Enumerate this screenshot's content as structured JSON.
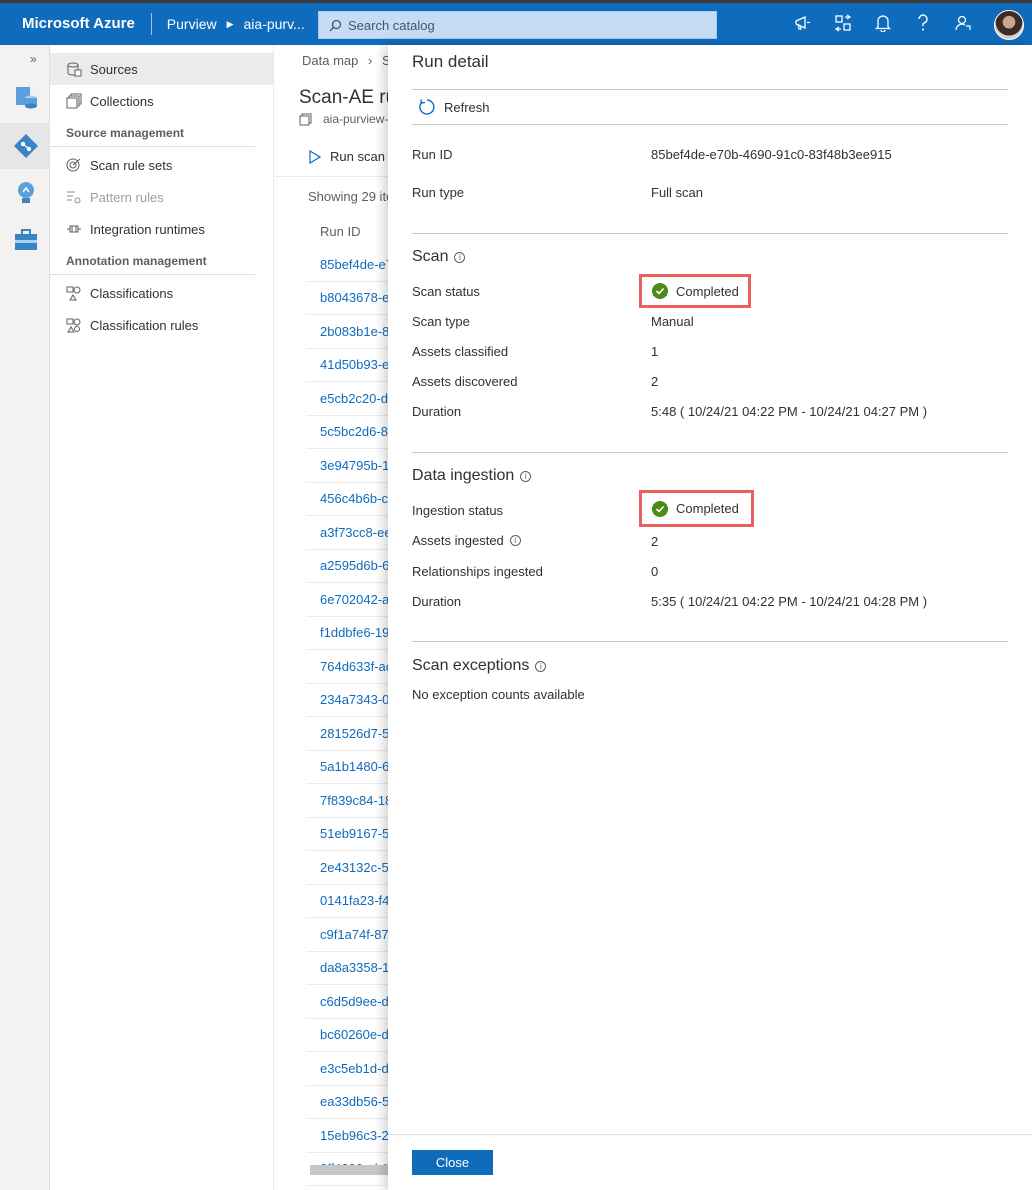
{
  "topbar": {
    "brand": "Microsoft Azure",
    "service": "Purview",
    "account": "aia-purv...",
    "search_placeholder": "Search catalog",
    "icons": [
      "megaphone-icon",
      "portal-switch-icon",
      "bell-icon",
      "help-icon",
      "feedback-icon"
    ]
  },
  "rail": {
    "expand": "»",
    "icons": [
      "data-catalog-icon",
      "data-map-icon",
      "insights-icon",
      "management-icon"
    ]
  },
  "nav": {
    "sources": "Sources",
    "collections": "Collections",
    "source_management": "Source management",
    "scan_rule_sets": "Scan rule sets",
    "pattern_rules": "Pattern rules",
    "integration_runtimes": "Integration runtimes",
    "annotation_management": "Annotation management",
    "classifications": "Classifications",
    "classification_rules": "Classification rules"
  },
  "middle": {
    "breadcrumb_1": "Data map",
    "breadcrumb_2": "So",
    "title": "Scan-AE ru",
    "subtitle": "aia-purview-",
    "run_scan": "Run scan n",
    "showing": "Showing 29 ite",
    "col_run_id": "Run ID",
    "run_ids": [
      "85bef4de-e7",
      "b8043678-e",
      "2b083b1e-8",
      "41d50b93-e",
      "e5cb2c20-d",
      "5c5bc2d6-8",
      "3e94795b-1",
      "456c4b6b-c",
      "a3f73cc8-ee",
      "a2595d6b-6",
      "6e702042-a",
      "f1ddbfe6-19",
      "764d633f-ac",
      "234a7343-0",
      "281526d7-5",
      "5a1b1480-6",
      "7f839c84-18",
      "51eb9167-5",
      "2e43132c-5",
      "0141fa23-f4",
      "c9f1a74f-87",
      "da8a3358-1",
      "c6d5d9ee-d",
      "bc60260e-d",
      "e3c5eb1d-d",
      "ea33db56-5",
      "15eb96c3-2",
      "0ff4090a-b1"
    ]
  },
  "panel": {
    "title": "Run detail",
    "refresh": "Refresh",
    "run_id_label": "Run ID",
    "run_id_value": "85bef4de-e70b-4690-91c0-83f48b3ee915",
    "run_type_label": "Run type",
    "run_type_value": "Full scan",
    "scan": {
      "heading": "Scan",
      "status_label": "Scan status",
      "status_value": "Completed",
      "type_label": "Scan type",
      "type_value": "Manual",
      "classified_label": "Assets classified",
      "classified_value": "1",
      "discovered_label": "Assets discovered",
      "discovered_value": "2",
      "duration_label": "Duration",
      "duration_value": "5:48 ( 10/24/21 04:22 PM - 10/24/21 04:27 PM )"
    },
    "ingestion": {
      "heading": "Data ingestion",
      "status_label": "Ingestion status",
      "status_value": "Completed",
      "assets_label": "Assets ingested",
      "assets_value": "2",
      "relationships_label": "Relationships ingested",
      "relationships_value": "0",
      "duration_label": "Duration",
      "duration_value": "5:35 ( 10/24/21 04:22 PM - 10/24/21 04:28 PM )"
    },
    "exceptions": {
      "heading": "Scan exceptions",
      "text": "No exception counts available"
    },
    "close": "Close"
  },
  "colors": {
    "brand_blue": "#0f6cbd",
    "success_green": "#4b8b1a",
    "highlight_red": "#e8605f"
  }
}
